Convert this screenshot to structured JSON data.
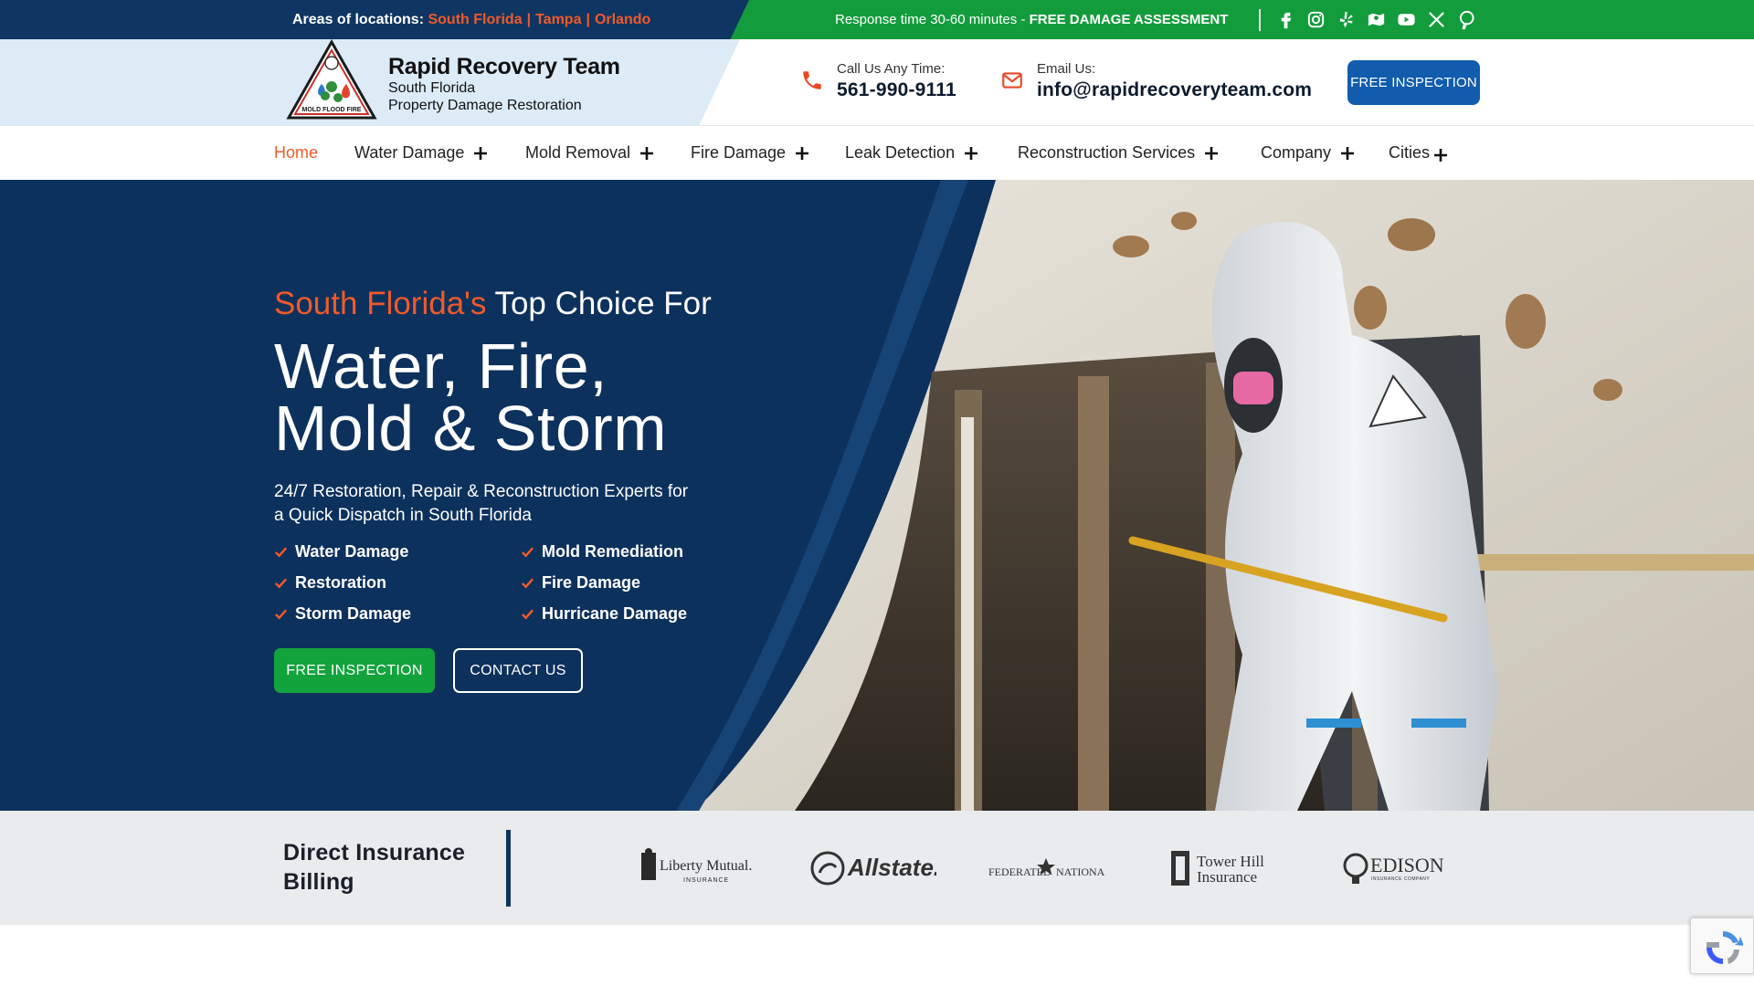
{
  "topbar": {
    "areas_label": "Areas of locations:",
    "cities": [
      "South Florida",
      "Tampa",
      "Orlando"
    ],
    "separator": "|",
    "response_text": "Response time 30-60 minutes - ",
    "response_bold": "FREE DAMAGE ASSESSMENT",
    "socials": [
      "facebook-icon",
      "instagram-icon",
      "yelp-icon",
      "map-icon",
      "youtube-icon",
      "x-icon",
      "pinterest-icon"
    ]
  },
  "brand": {
    "name": "Rapid Recovery Team",
    "region": "South Florida",
    "tagline": "Property Damage Restoration",
    "logo_text": "MOLD FLOOD FIRE"
  },
  "contacts": [
    {
      "label": "Call Us Any Time:",
      "value": "561-990-9111"
    },
    {
      "label": "Email Us:",
      "value": "info@rapidrecoveryteam.com"
    }
  ],
  "header_button": "FREE INSPECTION",
  "nav": [
    {
      "label": "Home",
      "active": true
    },
    {
      "label": "Water Damage"
    },
    {
      "label": "Mold Removal"
    },
    {
      "label": "Fire Damage"
    },
    {
      "label": "Leak Detection"
    },
    {
      "label": "Reconstruction Services"
    },
    {
      "label": "Company"
    },
    {
      "label": "Cities"
    }
  ],
  "hero": {
    "eyebrow_accent": "South Florida's",
    "eyebrow_rest": " Top Choice For",
    "headline_line1": "Water, Fire,",
    "headline_line2": "Mold & Storm",
    "description": "24/7 Restoration, Repair & Reconstruction Experts for a Quick Dispatch in South Florida",
    "checklist": [
      "Water Damage",
      "Mold Remediation",
      "Restoration",
      "Fire Damage",
      "Storm Damage",
      "Hurricane Damage"
    ],
    "primary_button": "FREE INSPECTION",
    "secondary_button": "CONTACT US"
  },
  "insurance": {
    "title": "Direct Insurance Billing",
    "logos": [
      {
        "name": "Liberty Mutual.",
        "sub": "INSURANCE"
      },
      {
        "name": "Allstate."
      },
      {
        "name": "FEDERATED",
        "name2": "NATIONAL"
      },
      {
        "name": "Tower Hill",
        "name2": "Insurance"
      },
      {
        "name": "EDISON",
        "sub": "INSURANCE COMPANY"
      }
    ]
  },
  "colors": {
    "navy": "#0f3562",
    "green": "#139c3c",
    "orange": "#ef5a2a",
    "button_blue": "#115cad"
  }
}
